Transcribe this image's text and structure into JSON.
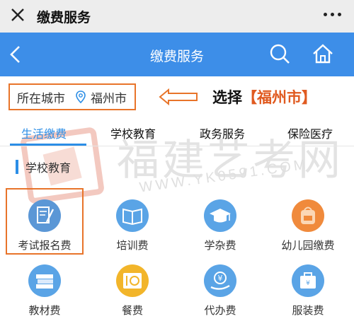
{
  "topbar": {
    "title": "缴费服务"
  },
  "navbar": {
    "title": "缴费服务"
  },
  "city": {
    "label": "所在城市",
    "value": "福州市"
  },
  "hint": {
    "prefix": "选择",
    "city": "【福州市】"
  },
  "tabs": [
    {
      "label": "生活缴费",
      "active": true
    },
    {
      "label": "学校教育",
      "active": false
    },
    {
      "label": "政务服务",
      "active": false
    },
    {
      "label": "保险医疗",
      "active": false
    }
  ],
  "section": {
    "title": "学校教育"
  },
  "watermark": {
    "text": "福建艺考网",
    "url": "WWW.YK0591.COM"
  },
  "items": [
    {
      "label": "考试报名费",
      "icon": "document-pen-icon",
      "color": "#5b97d6"
    },
    {
      "label": "培训费",
      "icon": "book-icon",
      "color": "#5aa4e6"
    },
    {
      "label": "学杂费",
      "icon": "graduation-cap-icon",
      "color": "#5aa4e6"
    },
    {
      "label": "幼儿园缴费",
      "icon": "backpack-icon",
      "color": "#f08a3c"
    },
    {
      "label": "教材费",
      "icon": "books-stack-icon",
      "color": "#5aa4e6"
    },
    {
      "label": "餐费",
      "icon": "meal-icon",
      "color": "#f2b52a"
    },
    {
      "label": "代办费",
      "icon": "yuan-hand-icon",
      "color": "#5aa4e6"
    },
    {
      "label": "服装费",
      "icon": "clothing-bag-icon",
      "color": "#5aa4e6"
    }
  ]
}
